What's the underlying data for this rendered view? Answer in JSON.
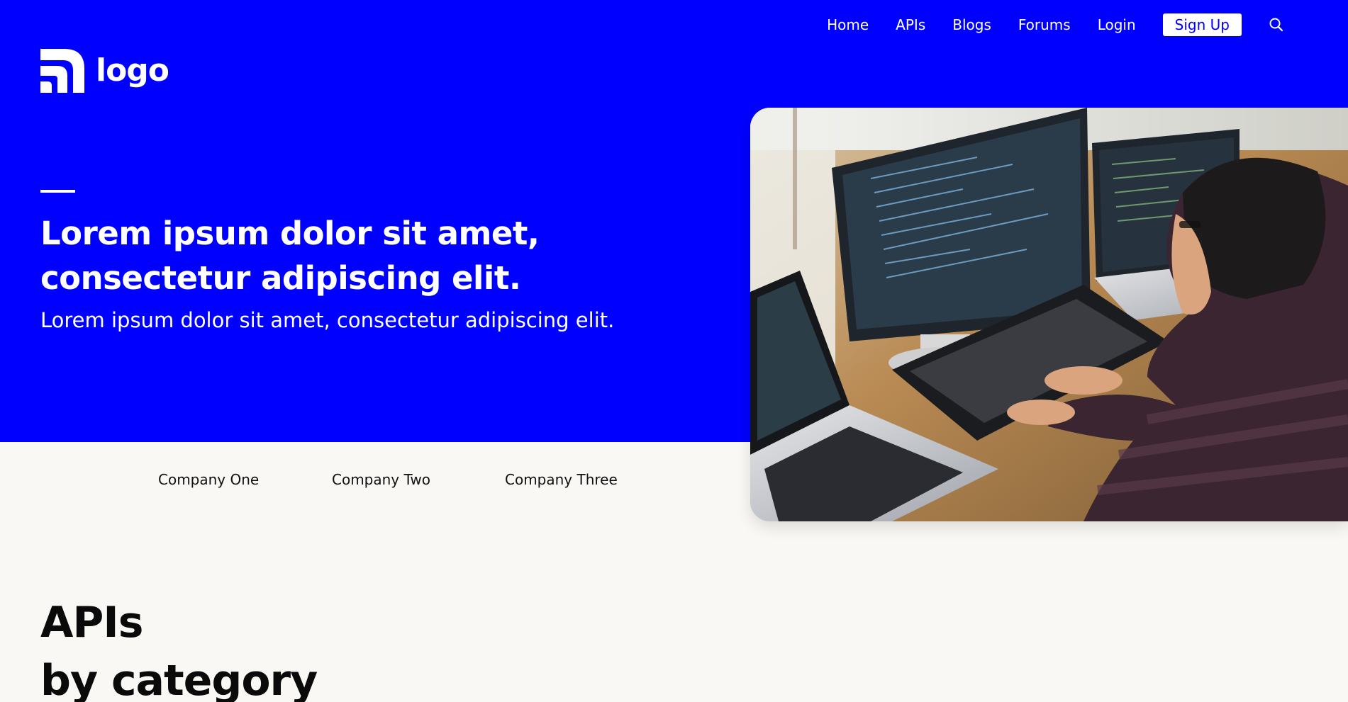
{
  "brand": {
    "logo_text": "logo",
    "accent_color": "#0000fe",
    "logo_icon": "signal-logo-icon"
  },
  "nav": {
    "items": [
      {
        "label": "Home"
      },
      {
        "label": "APIs"
      },
      {
        "label": "Blogs"
      },
      {
        "label": "Forums"
      },
      {
        "label": "Login"
      }
    ],
    "signup_label": "Sign Up",
    "search_icon": "search-icon"
  },
  "hero": {
    "headline_line1": "Lorem ipsum dolor sit amet,",
    "headline_line2": "consectetur adipiscing elit.",
    "subheadline": "Lorem ipsum dolor sit amet, consectetur adipiscing elit.",
    "image_subject": "developer-at-desk-photo"
  },
  "companies": [
    {
      "name": "Company One"
    },
    {
      "name": "Company Two"
    },
    {
      "name": "Company Three"
    }
  ],
  "section": {
    "title_line1": "APIs",
    "title_line2": "by category"
  }
}
